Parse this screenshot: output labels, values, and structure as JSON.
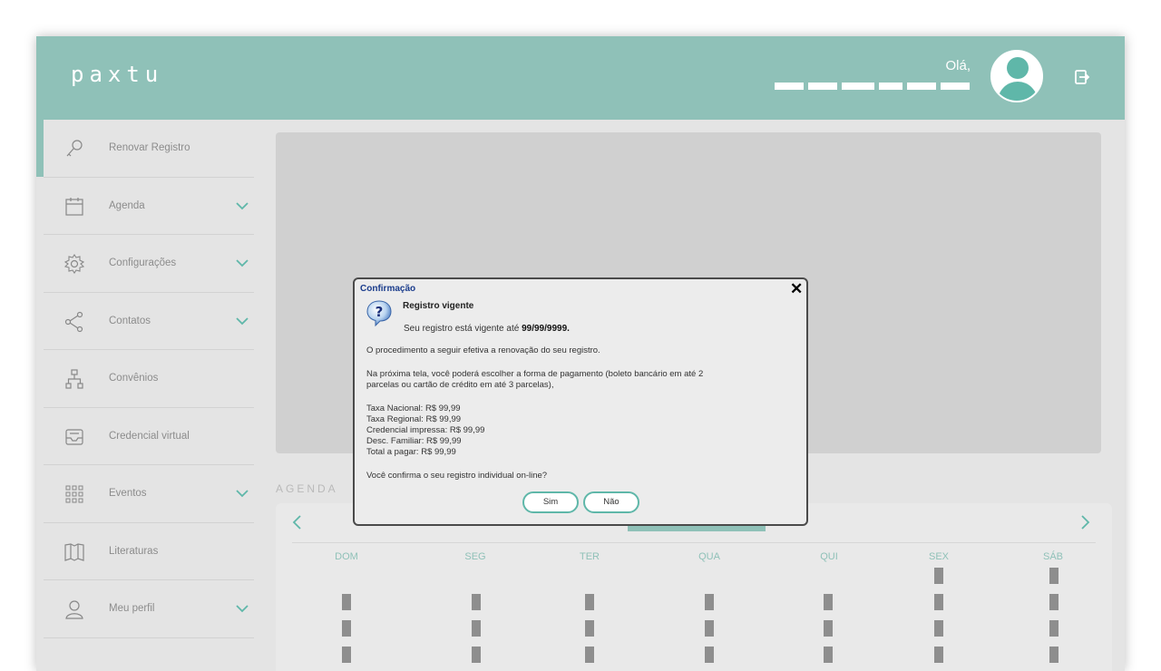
{
  "header": {
    "logo": "paxtu",
    "greeting": "Olá,",
    "brand_color": "#8fc1b8"
  },
  "sidebar": {
    "items": [
      {
        "label": "Renovar Registro",
        "icon": "key-icon",
        "expandable": false,
        "active": true
      },
      {
        "label": "Agenda",
        "icon": "calendar-icon",
        "expandable": true
      },
      {
        "label": "Configurações",
        "icon": "gear-icon",
        "expandable": true
      },
      {
        "label": "Contatos",
        "icon": "share-icon",
        "expandable": true
      },
      {
        "label": "Convênios",
        "icon": "org-chart-icon",
        "expandable": false
      },
      {
        "label": "Credencial virtual",
        "icon": "inbox-icon",
        "expandable": false
      },
      {
        "label": "Eventos",
        "icon": "grid-icon",
        "expandable": true
      },
      {
        "label": "Literaturas",
        "icon": "book-icon",
        "expandable": false
      },
      {
        "label": "Meu perfil",
        "icon": "user-icon",
        "expandable": true
      }
    ]
  },
  "agenda": {
    "title": "AGENDA",
    "weekdays": [
      "DOM",
      "SEG",
      "TER",
      "QUA",
      "QUI",
      "SEX",
      "SÁB"
    ]
  },
  "dialog": {
    "title": "Confirmação",
    "heading": "Registro vigente",
    "valid_prefix": "Seu registro está vigente até ",
    "valid_date": "99/99/9999.",
    "paragraph1": "O procedimento a seguir efetiva a renovação do seu registro.",
    "paragraph2_line1": "Na próxima tela, você poderá escolher a forma de pagamento (boleto bancário em até 2",
    "paragraph2_line2": "parcelas ou cartão de crédito em até 3 parcelas),",
    "fees": [
      "Taxa Nacional: R$ 99,99",
      "Taxa Regional: R$ 99,99",
      "Credencial impressa: R$ 99,99",
      "Desc. Familiar: R$ 99,99",
      "Total a pagar: R$ 99,99"
    ],
    "question": "Você confirma o seu registro individual on-line?",
    "yes_label": "Sim",
    "no_label": "Não",
    "close_label": "✕"
  }
}
